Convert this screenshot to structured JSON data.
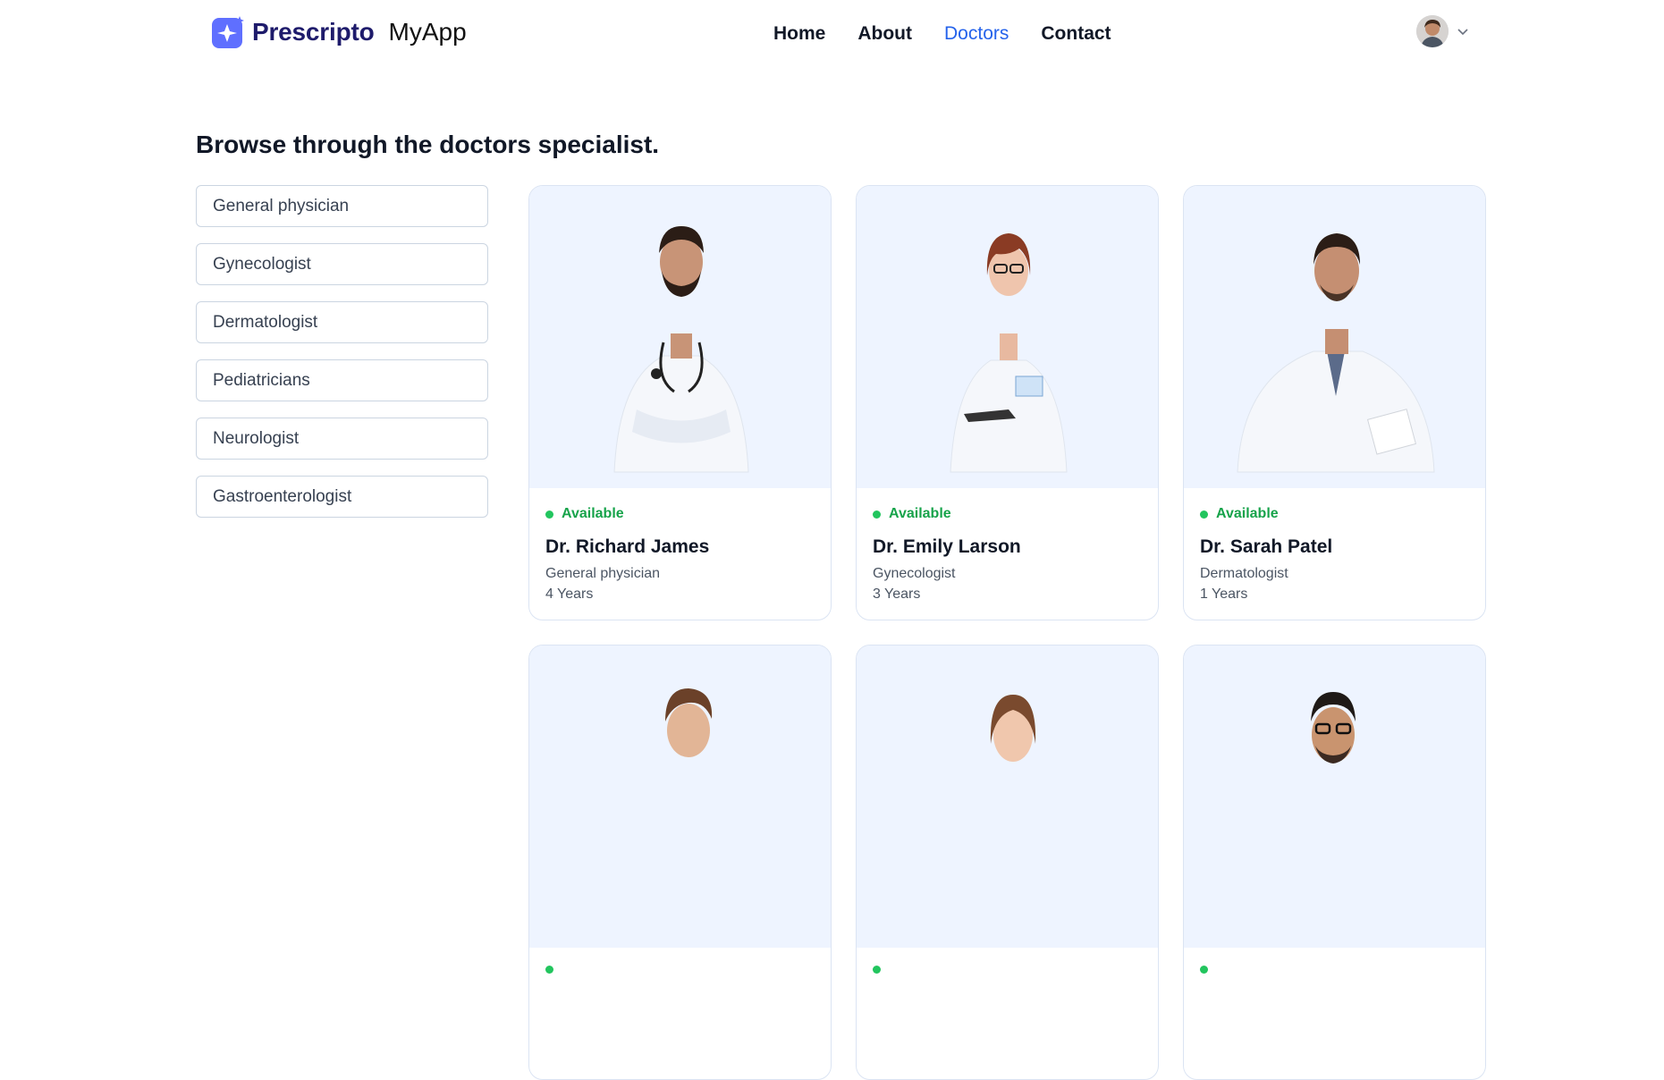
{
  "header": {
    "brand_name": "Prescripto",
    "app_name": "MyApp",
    "nav": [
      {
        "label": "Home",
        "active": false
      },
      {
        "label": "About",
        "active": false
      },
      {
        "label": "Doctors",
        "active": true
      },
      {
        "label": "Contact",
        "active": false
      }
    ],
    "accent_color": "#2563eb",
    "brand_color": "#5f6fff"
  },
  "page": {
    "title": "Browse through the doctors specialist."
  },
  "filters": [
    {
      "label": "General physician"
    },
    {
      "label": "Gynecologist"
    },
    {
      "label": "Dermatologist"
    },
    {
      "label": "Pediatricians"
    },
    {
      "label": "Neurologist"
    },
    {
      "label": "Gastroenterologist"
    }
  ],
  "doctors": [
    {
      "status": "Available",
      "name": "Dr. Richard James",
      "speciality": "General physician",
      "experience": "4 Years"
    },
    {
      "status": "Available",
      "name": "Dr. Emily Larson",
      "speciality": "Gynecologist",
      "experience": "3 Years"
    },
    {
      "status": "Available",
      "name": "Dr. Sarah Patel",
      "speciality": "Dermatologist",
      "experience": "1 Years"
    },
    {
      "status": "",
      "name": "",
      "speciality": "",
      "experience": ""
    },
    {
      "status": "",
      "name": "",
      "speciality": "",
      "experience": ""
    },
    {
      "status": "",
      "name": "",
      "speciality": "",
      "experience": ""
    }
  ],
  "status_color": "#16a34a",
  "card_image_bg": "#eef4ff"
}
